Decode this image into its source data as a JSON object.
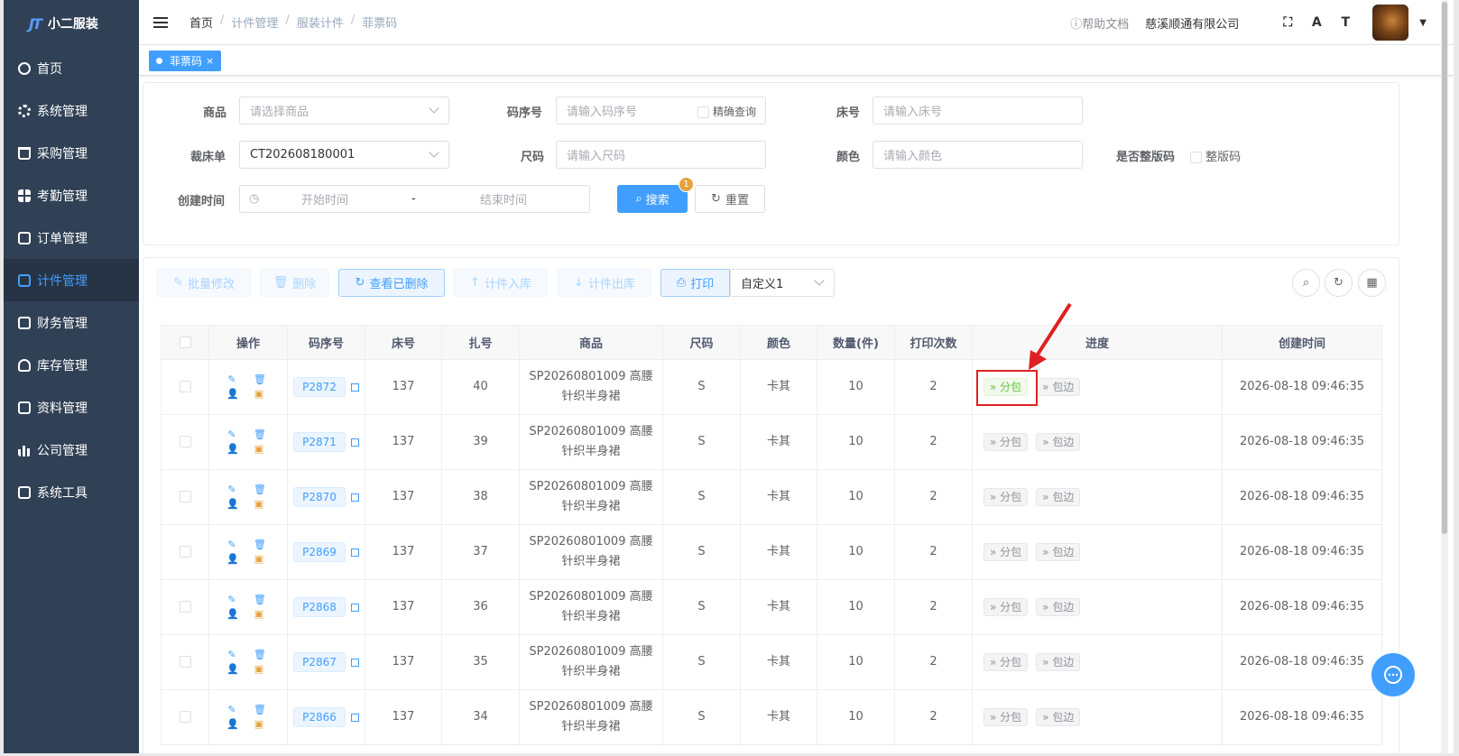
{
  "app": {
    "logo_mark": "JT",
    "name": "小二服装"
  },
  "sidebar": {
    "items": [
      {
        "label": "首页",
        "icon": "home-icon"
      },
      {
        "label": "系统管理",
        "icon": "gear-icon"
      },
      {
        "label": "采购管理",
        "icon": "cart-icon"
      },
      {
        "label": "考勤管理",
        "icon": "grid-icon"
      },
      {
        "label": "订单管理",
        "icon": "order-icon"
      },
      {
        "label": "计件管理",
        "icon": "piecework-icon",
        "active": true
      },
      {
        "label": "财务管理",
        "icon": "finance-icon"
      },
      {
        "label": "库存管理",
        "icon": "user-icon"
      },
      {
        "label": "资料管理",
        "icon": "doc-icon"
      },
      {
        "label": "公司管理",
        "icon": "chart-icon"
      },
      {
        "label": "系统工具",
        "icon": "toolbox-icon"
      }
    ]
  },
  "breadcrumb": {
    "home": "首页",
    "level1": "计件管理",
    "level2": "服装计件",
    "current": "菲票码",
    "sep": "/"
  },
  "navbar": {
    "help": "帮助文档",
    "company": "慈溪顺通有限公司"
  },
  "tags": {
    "active": "菲票码"
  },
  "search": {
    "product_label": "商品",
    "product_placeholder": "请选择商品",
    "code_label": "码序号",
    "code_placeholder": "请输入码序号",
    "exact_label": "精确查询",
    "bed_label": "床号",
    "bed_placeholder": "请输入床号",
    "cut_label": "裁床单",
    "cut_value": "CT202608180001",
    "size_label": "尺码",
    "size_placeholder": "请输入尺码",
    "color_label": "颜色",
    "color_placeholder": "请输入颜色",
    "whole_label": "是否整版码",
    "whole_option": "整版码",
    "time_label": "创建时间",
    "start_placeholder": "开始时间",
    "range_sep": "-",
    "end_placeholder": "结束时间",
    "search_btn": "搜索",
    "search_badge": "1",
    "reset_btn": "重置"
  },
  "toolbar": {
    "batch_edit": "批量修改",
    "delete": "删除",
    "view_deleted": "查看已删除",
    "stock_in": "计件入库",
    "stock_out": "计件出库",
    "print": "打印",
    "template": "自定义1"
  },
  "table": {
    "headers": [
      "",
      "操作",
      "码序号",
      "床号",
      "扎号",
      "商品",
      "尺码",
      "颜色",
      "数量(件)",
      "打印次数",
      "进度",
      "创建时间"
    ],
    "progress": {
      "step1": "分包",
      "step2": "包边"
    },
    "rows": [
      {
        "code": "P2872",
        "bed": "137",
        "bundle": "40",
        "product": "SP20260801009 高腰针织半身裙",
        "size": "S",
        "color": "卡其",
        "qty": "10",
        "prints": "2",
        "created": "2026-08-18 09:46:35",
        "done": true
      },
      {
        "code": "P2871",
        "bed": "137",
        "bundle": "39",
        "product": "SP20260801009 高腰针织半身裙",
        "size": "S",
        "color": "卡其",
        "qty": "10",
        "prints": "2",
        "created": "2026-08-18 09:46:35"
      },
      {
        "code": "P2870",
        "bed": "137",
        "bundle": "38",
        "product": "SP20260801009 高腰针织半身裙",
        "size": "S",
        "color": "卡其",
        "qty": "10",
        "prints": "2",
        "created": "2026-08-18 09:46:35"
      },
      {
        "code": "P2869",
        "bed": "137",
        "bundle": "37",
        "product": "SP20260801009 高腰针织半身裙",
        "size": "S",
        "color": "卡其",
        "qty": "10",
        "prints": "2",
        "created": "2026-08-18 09:46:35"
      },
      {
        "code": "P2868",
        "bed": "137",
        "bundle": "36",
        "product": "SP20260801009 高腰针织半身裙",
        "size": "S",
        "color": "卡其",
        "qty": "10",
        "prints": "2",
        "created": "2026-08-18 09:46:35"
      },
      {
        "code": "P2867",
        "bed": "137",
        "bundle": "35",
        "product": "SP20260801009 高腰针织半身裙",
        "size": "S",
        "color": "卡其",
        "qty": "10",
        "prints": "2",
        "created": "2026-08-18 09:46:35"
      },
      {
        "code": "P2866",
        "bed": "137",
        "bundle": "34",
        "product": "SP20260801009 高腰针织半身裙",
        "size": "S",
        "color": "卡其",
        "qty": "10",
        "prints": "2",
        "created": "2026-08-18 09:46:35"
      }
    ]
  }
}
